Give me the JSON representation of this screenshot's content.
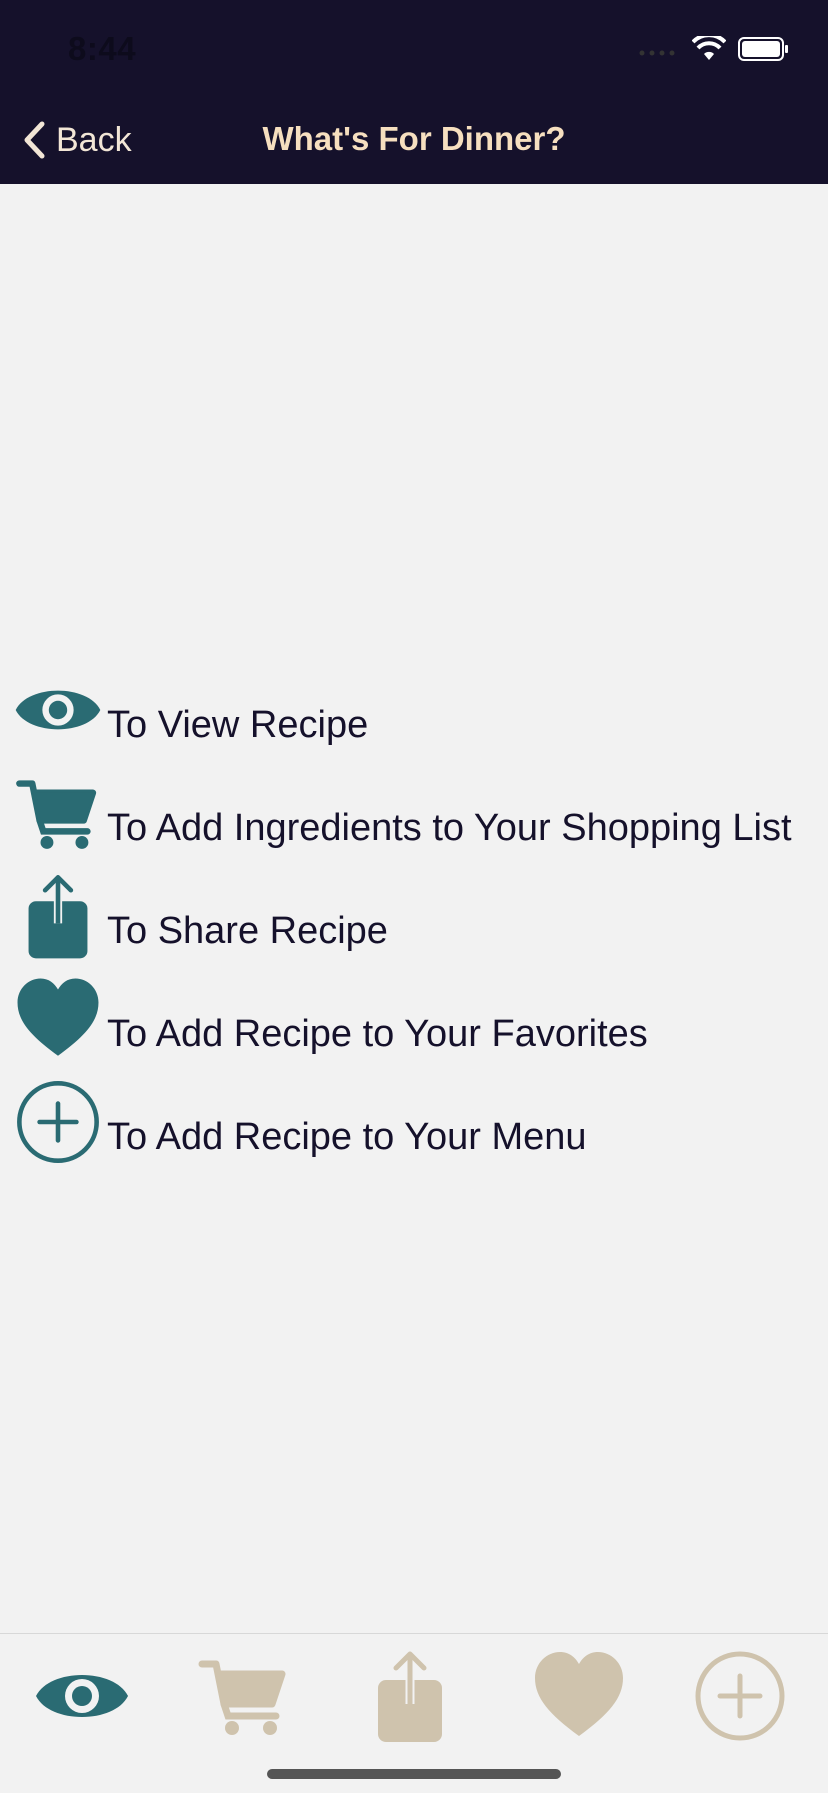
{
  "status_bar": {
    "time": "8:44"
  },
  "nav": {
    "back_label": "Back",
    "title": "What's For Dinner?"
  },
  "legend": [
    {
      "icon": "eye-icon",
      "text": "To View Recipe"
    },
    {
      "icon": "cart-icon",
      "text": "To Add Ingredients to Your Shopping List"
    },
    {
      "icon": "share-icon",
      "text": "To Share Recipe"
    },
    {
      "icon": "heart-icon",
      "text": "To Add Recipe to Your Favorites"
    },
    {
      "icon": "add-circle-icon",
      "text": "To Add Recipe to Your Menu"
    }
  ],
  "tab_bar": {
    "items": [
      {
        "name": "view",
        "icon": "eye-icon",
        "selected": true
      },
      {
        "name": "cart",
        "icon": "cart-icon",
        "selected": false
      },
      {
        "name": "share",
        "icon": "share-icon",
        "selected": false
      },
      {
        "name": "favorites",
        "icon": "heart-icon",
        "selected": false
      },
      {
        "name": "add",
        "icon": "add-circle-icon",
        "selected": false
      }
    ]
  },
  "colors": {
    "nav_background": "#15112b",
    "nav_text": "#f6dfbf",
    "icon_active": "#2a6b73",
    "icon_inactive": "#cfc3ad",
    "background": "#f2f2f2"
  }
}
